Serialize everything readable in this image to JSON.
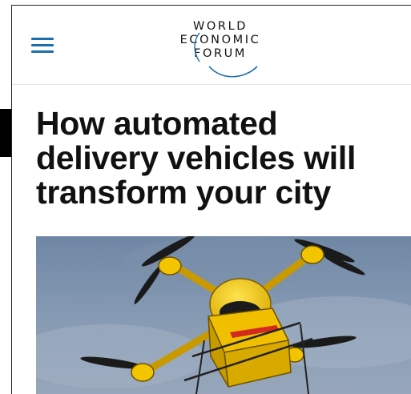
{
  "header": {
    "menu_icon": "hamburger-menu-icon",
    "logo": {
      "line1": "WORLD",
      "line2": "ECONOMIC",
      "line3": "FORUM",
      "accent_color": "#1b6fad"
    }
  },
  "article": {
    "title": "How automated delivery vehicles will transform your city",
    "hero_image": "delivery-drone-photo"
  },
  "colors": {
    "accent": "#1b6fad",
    "text": "#111111",
    "drone_yellow": "#f2c500",
    "sky": "#7f93ad"
  }
}
